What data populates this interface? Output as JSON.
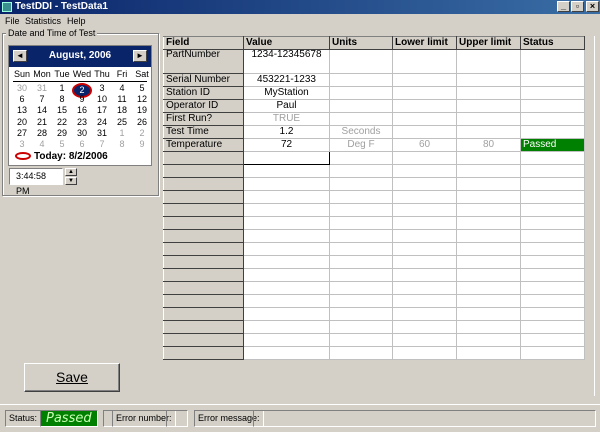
{
  "window": {
    "title": "TestDDI - TestData1"
  },
  "menu": {
    "items": [
      "File",
      "Statistics",
      "Help"
    ]
  },
  "group": {
    "label": "Date and Time of Test"
  },
  "calendar": {
    "month_label": "August, 2006",
    "prev": "◄",
    "next": "►",
    "dow": [
      "Sun",
      "Mon",
      "Tue",
      "Wed",
      "Thu",
      "Fri",
      "Sat"
    ],
    "weeks": [
      [
        {
          "d": "30",
          "g": true
        },
        {
          "d": "31",
          "g": true
        },
        {
          "d": "1"
        },
        {
          "d": "2",
          "sel": true
        },
        {
          "d": "3"
        },
        {
          "d": "4"
        },
        {
          "d": "5"
        }
      ],
      [
        {
          "d": "6"
        },
        {
          "d": "7"
        },
        {
          "d": "8"
        },
        {
          "d": "9"
        },
        {
          "d": "10"
        },
        {
          "d": "11"
        },
        {
          "d": "12"
        }
      ],
      [
        {
          "d": "13"
        },
        {
          "d": "14"
        },
        {
          "d": "15"
        },
        {
          "d": "16"
        },
        {
          "d": "17"
        },
        {
          "d": "18"
        },
        {
          "d": "19"
        }
      ],
      [
        {
          "d": "20"
        },
        {
          "d": "21"
        },
        {
          "d": "22"
        },
        {
          "d": "23"
        },
        {
          "d": "24"
        },
        {
          "d": "25"
        },
        {
          "d": "26"
        }
      ],
      [
        {
          "d": "27"
        },
        {
          "d": "28"
        },
        {
          "d": "29"
        },
        {
          "d": "30"
        },
        {
          "d": "31"
        },
        {
          "d": "1",
          "g": true
        },
        {
          "d": "2",
          "g": true
        }
      ],
      [
        {
          "d": "3",
          "g": true
        },
        {
          "d": "4",
          "g": true
        },
        {
          "d": "5",
          "g": true
        },
        {
          "d": "6",
          "g": true
        },
        {
          "d": "7",
          "g": true
        },
        {
          "d": "8",
          "g": true
        },
        {
          "d": "9",
          "g": true
        }
      ]
    ],
    "today": "Today: 8/2/2006"
  },
  "time": {
    "value": "3:44:58 PM"
  },
  "grid": {
    "columns": [
      "Field",
      "Value",
      "Units",
      "Lower limit",
      "Upper limit",
      "Status"
    ],
    "rows": [
      {
        "field": "PartNumber",
        "value": "1234-12345678",
        "units": "",
        "lower": "",
        "upper": "",
        "status": ""
      },
      {
        "field": "Serial Number",
        "value": "453221-1233",
        "units": "",
        "lower": "",
        "upper": "",
        "status": ""
      },
      {
        "field": "Station ID",
        "value": "MyStation",
        "units": "",
        "lower": "",
        "upper": "",
        "status": ""
      },
      {
        "field": "Operator ID",
        "value": "Paul",
        "units": "",
        "lower": "",
        "upper": "",
        "status": ""
      },
      {
        "field": "First Run?",
        "value": "TRUE",
        "units": "",
        "lower": "",
        "upper": "",
        "status": ""
      },
      {
        "field": "Test Time",
        "value": "1.2",
        "units": "Seconds",
        "lower": "",
        "upper": "",
        "status": ""
      },
      {
        "field": "Temperature",
        "value": "72",
        "units": "Deg F",
        "lower": "60",
        "upper": "80",
        "status": "Passed"
      }
    ],
    "empty_rows": 16
  },
  "save": {
    "label": "Save"
  },
  "status": {
    "status_label": "Status:",
    "status_value": "Passed",
    "error_number_label": "Error number:",
    "error_message_label": "Error message:"
  },
  "colors": {
    "pass": "#008000",
    "title": "#0a246a"
  }
}
